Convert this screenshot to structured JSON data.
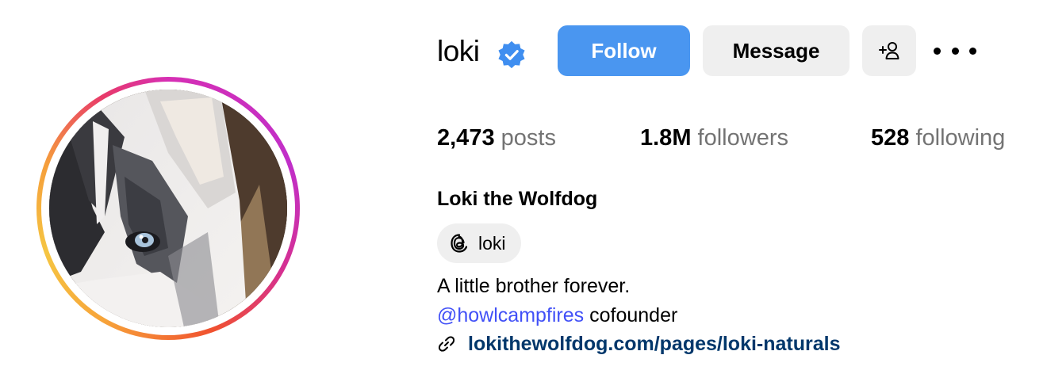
{
  "profile": {
    "username": "loki",
    "verified": true,
    "full_name": "Loki the Wolfdog",
    "threads_handle": "loki",
    "bio_line1": "A little brother forever.",
    "bio_mention": "@howlcampfires",
    "bio_line2_rest": " cofounder",
    "website": "lokithewolfdog.com/pages/loki-naturals"
  },
  "actions": {
    "follow_label": "Follow",
    "message_label": "Message",
    "add_user_icon": "add-user-icon",
    "more_icon": "more-options-icon"
  },
  "stats": {
    "posts_count": "2,473",
    "posts_label": "posts",
    "followers_count": "1.8M",
    "followers_label": "followers",
    "following_count": "528",
    "following_label": "following"
  },
  "colors": {
    "follow_button": "#4a96f0",
    "secondary_button": "#efefef",
    "verified_badge": "#3f8ef0",
    "mention": "#4150f7",
    "link": "#00376b",
    "muted_text": "#737373"
  }
}
